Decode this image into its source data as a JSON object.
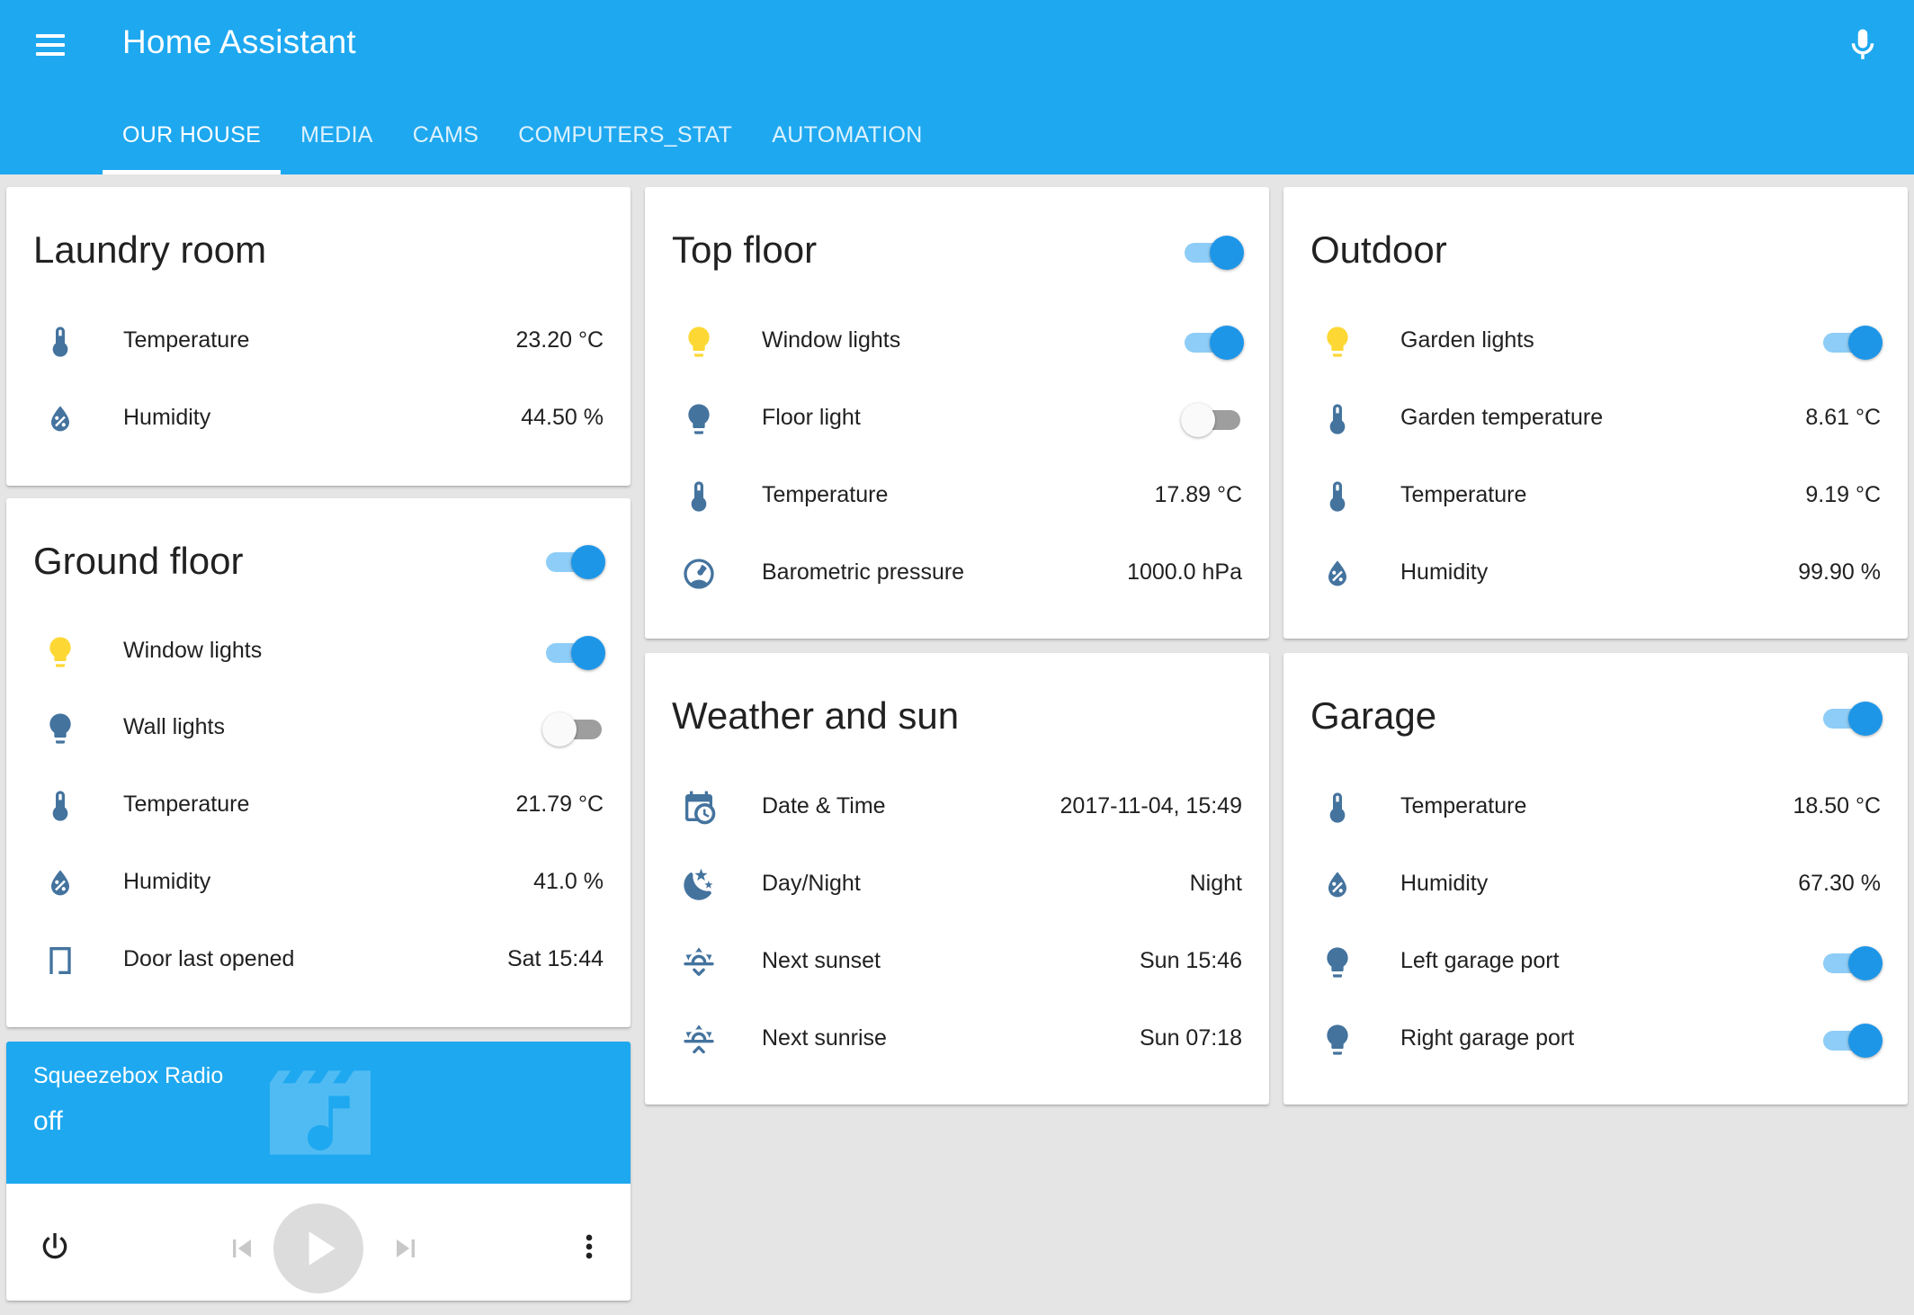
{
  "app": {
    "title": "Home Assistant"
  },
  "tabs": [
    "OUR HOUSE",
    "MEDIA",
    "CAMS",
    "COMPUTERS_STAT",
    "AUTOMATION"
  ],
  "colors": {
    "primary": "#1ea8f0",
    "toggle_on": "#1e96e8",
    "icon_blue": "#44739e",
    "bulb_on": "#fdd835"
  },
  "laundry": {
    "title": "Laundry room",
    "rows": [
      {
        "icon": "thermometer-icon",
        "label": "Temperature",
        "value": "23.20 °C"
      },
      {
        "icon": "water-percent-icon",
        "label": "Humidity",
        "value": "44.50 %"
      }
    ]
  },
  "ground": {
    "title": "Ground floor",
    "toggle": true,
    "rows": [
      {
        "icon": "lightbulb-on-icon",
        "label": "Window lights",
        "toggle": true
      },
      {
        "icon": "lightbulb-off-icon",
        "label": "Wall lights",
        "toggle": false
      },
      {
        "icon": "thermometer-icon",
        "label": "Temperature",
        "value": "21.79 °C"
      },
      {
        "icon": "water-percent-icon",
        "label": "Humidity",
        "value": "41.0 %"
      },
      {
        "icon": "door-icon",
        "label": "Door last opened",
        "value": "Sat 15:44"
      }
    ]
  },
  "media": {
    "name": "Squeezebox Radio",
    "state": "off"
  },
  "top": {
    "title": "Top floor",
    "toggle": true,
    "rows": [
      {
        "icon": "lightbulb-on-icon",
        "label": "Window lights",
        "toggle": true
      },
      {
        "icon": "lightbulb-off-icon",
        "label": "Floor light",
        "toggle": false
      },
      {
        "icon": "thermometer-icon",
        "label": "Temperature",
        "value": "17.89 °C"
      },
      {
        "icon": "gauge-icon",
        "label": "Barometric pressure",
        "value": "1000.0 hPa"
      }
    ]
  },
  "weather": {
    "title": "Weather and sun",
    "rows": [
      {
        "icon": "calendar-clock-icon",
        "label": "Date & Time",
        "value": "2017-11-04, 15:49"
      },
      {
        "icon": "weather-night-icon",
        "label": "Day/Night",
        "value": "Night"
      },
      {
        "icon": "sunset-down-icon",
        "label": "Next sunset",
        "value": "Sun 15:46"
      },
      {
        "icon": "sunrise-up-icon",
        "label": "Next sunrise",
        "value": "Sun 07:18"
      }
    ]
  },
  "outdoor": {
    "title": "Outdoor",
    "rows": [
      {
        "icon": "lightbulb-on-icon",
        "label": "Garden lights",
        "toggle": true
      },
      {
        "icon": "thermometer-icon",
        "label": "Garden temperature",
        "value": "8.61 °C"
      },
      {
        "icon": "thermometer-icon",
        "label": "Temperature",
        "value": "9.19 °C"
      },
      {
        "icon": "water-percent-icon",
        "label": "Humidity",
        "value": "99.90 %"
      }
    ]
  },
  "garage": {
    "title": "Garage",
    "toggle": true,
    "rows": [
      {
        "icon": "thermometer-icon",
        "label": "Temperature",
        "value": "18.50 °C"
      },
      {
        "icon": "water-percent-icon",
        "label": "Humidity",
        "value": "67.30 %"
      },
      {
        "icon": "lightbulb-off-icon",
        "label": "Left garage port",
        "toggle": true
      },
      {
        "icon": "lightbulb-off-icon",
        "label": "Right garage port",
        "toggle": true
      }
    ]
  }
}
